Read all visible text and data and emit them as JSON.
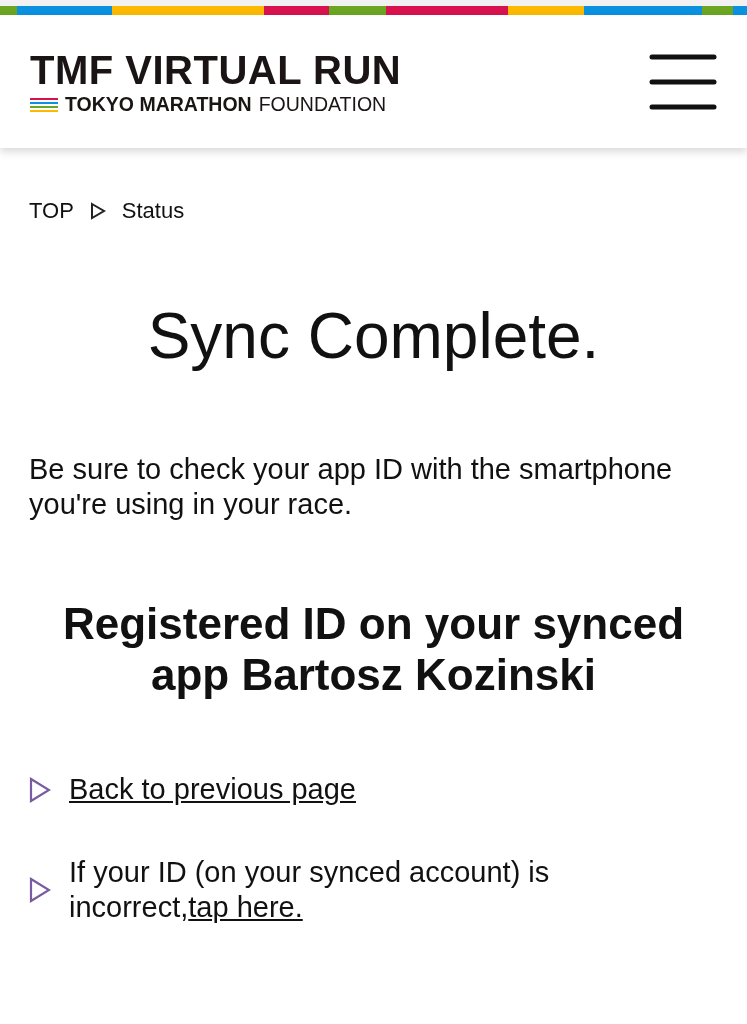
{
  "header": {
    "logo_title": "TMF VIRTUAL RUN",
    "logo_subtitle_bold": "TOKYO MARATHON",
    "logo_subtitle_light": "FOUNDATION"
  },
  "breadcrumb": [
    {
      "label": "TOP"
    },
    {
      "label": "Status"
    }
  ],
  "title": "Sync Complete.",
  "notice": "Be sure to check your app ID with the smartphone you're using in your race.",
  "heading": "Registered ID on your synced app Bartosz Kozinski",
  "links": [
    {
      "kind": "link",
      "text": "Back to previous page"
    },
    {
      "kind": "sentence",
      "text": "If your ID (on your synced account) is incorrect,",
      "link_text": "tap here."
    }
  ]
}
